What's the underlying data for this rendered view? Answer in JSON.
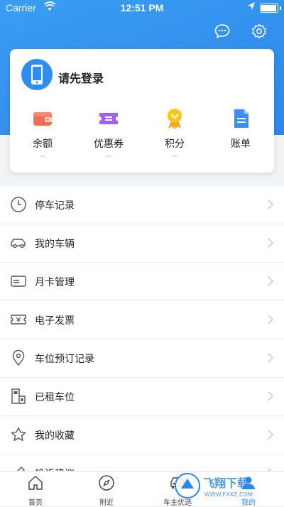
{
  "status_bar": {
    "carrier": "Carrier",
    "time": "12:51 PM"
  },
  "header": {
    "message_icon": "chat-bubble-icon",
    "settings_icon": "gear-icon"
  },
  "profile": {
    "login_prompt": "请先登录",
    "stats": [
      {
        "label": "余额",
        "value": "--",
        "icon": "wallet-icon"
      },
      {
        "label": "优惠券",
        "value": "--",
        "icon": "coupon-icon"
      },
      {
        "label": "积分",
        "value": "--",
        "icon": "medal-icon"
      },
      {
        "label": "账单",
        "value": "",
        "icon": "bill-icon"
      }
    ]
  },
  "menu": [
    {
      "label": "停车记录",
      "icon": "clock-icon"
    },
    {
      "label": "我的车辆",
      "icon": "car-icon"
    },
    {
      "label": "月卡管理",
      "icon": "card-icon"
    },
    {
      "label": "电子发票",
      "icon": "invoice-icon"
    },
    {
      "label": "车位预订记录",
      "icon": "location-pin-icon"
    },
    {
      "label": "已租车位",
      "icon": "parking-lot-icon"
    },
    {
      "label": "我的收藏",
      "icon": "star-icon"
    },
    {
      "label": "投诉建议",
      "icon": "pencil-icon"
    }
  ],
  "tabs": [
    {
      "label": "首页",
      "icon": "home-icon"
    },
    {
      "label": "附近",
      "icon": "compass-icon"
    },
    {
      "label": "车主优选",
      "icon": "car-front-icon"
    },
    {
      "label": "我的",
      "icon": "user-icon"
    }
  ],
  "watermark": {
    "text": "飞翔下载",
    "sub": "WWW.FXXZ.COM"
  },
  "colors": {
    "primary": "#2d87ea",
    "background": "#f2f3f5"
  }
}
